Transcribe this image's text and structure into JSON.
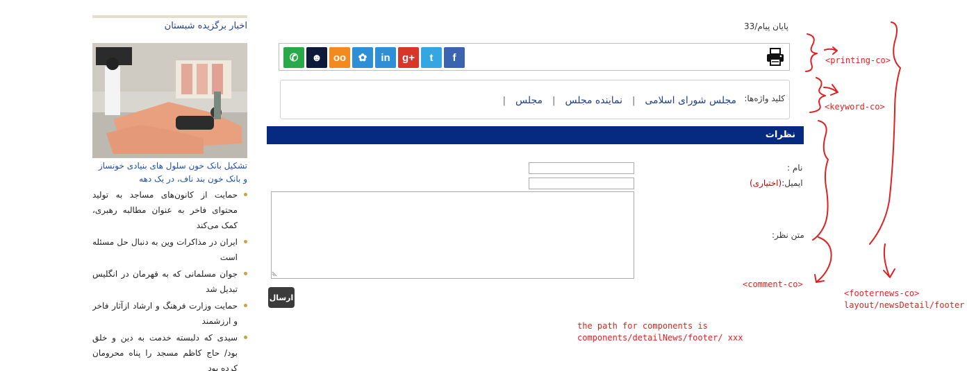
{
  "sidebar": {
    "title": "اخبار برگزیده شبستان",
    "featured_caption": "تشکیل بانک خون سلول های بنیادی خونساز و بانک خون بند ناف، در یک دهه",
    "items": [
      {
        "text": "حمایت از کانون‌های مساجد به تولید محتوای فاخر به عنوان مطالبه رهبری، کمک می‌کند"
      },
      {
        "text": "ایران در مذاکرات وین به دنبال حل مسئله است"
      },
      {
        "text": "جوان مسلمانی که به قهرمان در انگلیس تبدیل شد"
      },
      {
        "text": "حمایت وزارت فرهنگ و ارشاد ازآثار فاخر و ارزشمند"
      },
      {
        "text": "سیدی که دلبسته خدمت به دین و خلق بود/ حاج کاظم مسجد را پناه محرومان کرده بود"
      }
    ]
  },
  "article_footer": {
    "end_message": "پایان پیام/33",
    "share_icons": [
      {
        "name": "whatsapp-icon",
        "color": "#2aa94a",
        "glyph": "✆"
      },
      {
        "name": "baleh-icon",
        "color": "#0d1a3a",
        "glyph": "☻"
      },
      {
        "name": "cloob-icon",
        "color": "#f28a1e",
        "glyph": "oo"
      },
      {
        "name": "soroush-icon",
        "color": "#2f8fd6",
        "glyph": "✿"
      },
      {
        "name": "linkedin-icon",
        "color": "#2f8fd6",
        "glyph": "in"
      },
      {
        "name": "googleplus-icon",
        "color": "#d9362b",
        "glyph": "g+"
      },
      {
        "name": "twitter-icon",
        "color": "#34a7e2",
        "glyph": "t"
      },
      {
        "name": "facebook-icon",
        "color": "#3b64b0",
        "glyph": "f"
      }
    ],
    "keywords_label": "کلید واژه‌ها:",
    "keywords": [
      "مجلس شورای اسلامی",
      "نماینده مجلس",
      "مجلس"
    ],
    "keyword_separator": "|"
  },
  "comments": {
    "header": "نظرات",
    "name_label": "نام :",
    "email_label": "ایمیل:",
    "email_optional": "(اختیاری)",
    "body_label": "متن نظر:",
    "name_value": "",
    "email_value": "",
    "body_value": "",
    "submit_label": "ارسال"
  },
  "annotations": {
    "printing": "<printing-co>",
    "keyword": "<keyword-co>",
    "comment": "<comment-co>",
    "footernews_line1": "<footernews-co>",
    "footernews_line2": "layout/newsDetail/footer",
    "path_note_line1": "the path for components is",
    "path_note_line2": "components/detailNews/footer/ xxx"
  },
  "colors": {
    "header_bar": "#062a80",
    "link": "#1f3e8c",
    "annotation": "#e02020",
    "bullet": "#c9a440"
  }
}
